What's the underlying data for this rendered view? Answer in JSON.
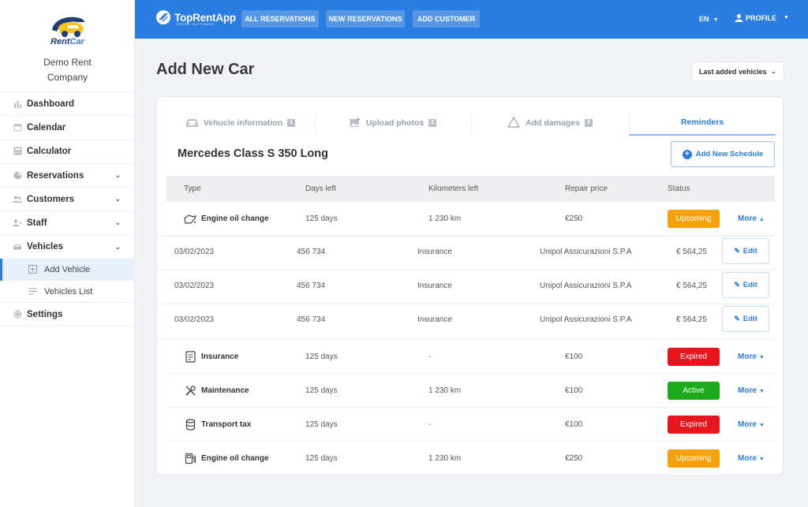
{
  "sidebar": {
    "logo_text_a": "Rent",
    "logo_text_b": "Car",
    "company": "Demo Rent Company",
    "items": [
      {
        "label": "Dashboard",
        "icon": "bar-chart-icon"
      },
      {
        "label": "Calendar",
        "icon": "calendar-icon"
      },
      {
        "label": "Calculator",
        "icon": "calculator-icon"
      },
      {
        "label": "Reservations",
        "icon": "pie-chart-icon"
      },
      {
        "label": "Customers",
        "icon": "users-icon"
      },
      {
        "label": "Staff",
        "icon": "staff-icon"
      },
      {
        "label": "Vehicles",
        "icon": "car-icon"
      }
    ],
    "sub_items": [
      {
        "label": "Add Vehicle",
        "icon": "plus-square-icon"
      },
      {
        "label": "Vehicles List",
        "icon": "list-icon"
      }
    ],
    "settings": "Settings"
  },
  "topbar": {
    "brand_name": "TopRentApp",
    "brand_sub": "RENTAL SOFTWARE",
    "buttons": [
      "ALL RESERVATIONS",
      "NEW RESERVATIONS",
      "ADD CUSTOMER"
    ],
    "lang": "EN",
    "profile": "PROFILE"
  },
  "page": {
    "title": "Add New Car",
    "last_added": "Last added vehicles"
  },
  "tabs": [
    {
      "label": "Vehucle information",
      "num": "1"
    },
    {
      "label": "Upload photos",
      "num": "2"
    },
    {
      "label": "Add damages",
      "num": "3"
    },
    {
      "label": "Reminders",
      "num": ""
    }
  ],
  "car_name": "Mercedes Class S 350 Long",
  "add_schedule": "Add New Schedule",
  "table": {
    "headers": [
      "Type",
      "Days left",
      "Kilometers left",
      "Repair price",
      "Status"
    ],
    "rows": [
      {
        "type": "Engine oil change",
        "days": "125 days",
        "km": "1 230 km",
        "price": "€250",
        "status": "Upcoming",
        "more": "More"
      },
      {
        "type": "Insurance",
        "days": "125 days",
        "km": "-",
        "price": "€100",
        "status": "Expired",
        "more": "More"
      },
      {
        "type": "Maintenance",
        "days": "125 days",
        "km": "1 230 km",
        "price": "€100",
        "status": "Active",
        "more": "More"
      },
      {
        "type": "Transport tax",
        "days": "125 days",
        "km": "-",
        "price": "€100",
        "status": "Expired",
        "more": "More"
      },
      {
        "type": "Engine oil change",
        "days": "125 days",
        "km": "1 230 km",
        "price": "€250",
        "status": "Upcoming",
        "more": "More"
      }
    ],
    "sub_rows": [
      {
        "date": "03/02/2023",
        "num": "456 734",
        "kind": "Insurance",
        "company": "Unipol Assicurazioni S.P.A",
        "amount": "€ 564,25",
        "edit": "Edit"
      },
      {
        "date": "03/02/2023",
        "num": "456 734",
        "kind": "Insurance",
        "company": "Unipol Assicurazioni S.P.A",
        "amount": "€ 564,25",
        "edit": "Edit"
      },
      {
        "date": "03/02/2023",
        "num": "456 734",
        "kind": "Insurance",
        "company": "Unipol Assicurazioni S.P.A",
        "amount": "€ 564,25",
        "edit": "Edit"
      }
    ]
  },
  "colors": {
    "primary": "#2a7de1",
    "upcoming": "#f7a20c",
    "expired": "#e5161d",
    "active": "#1bab1b"
  }
}
